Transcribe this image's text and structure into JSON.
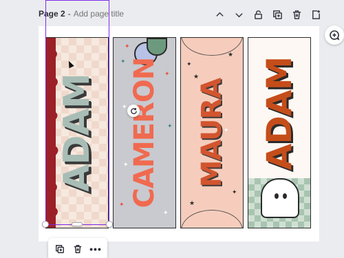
{
  "page": {
    "number_label": "Page 2",
    "separator": "-",
    "title_placeholder": "Add page title"
  },
  "toolbar": {
    "icons": [
      "chevron-up-icon",
      "chevron-down-icon",
      "lock-icon",
      "duplicate-page-icon",
      "delete-page-icon",
      "add-page-icon"
    ]
  },
  "side_action": {
    "icon": "comment-add-icon"
  },
  "bookmarks": [
    {
      "name": "ADAM",
      "colors": {
        "text": "#a8bdb6",
        "accent": "#9b2027",
        "background": "#f6e9df"
      }
    },
    {
      "name": "CAMERON",
      "colors": {
        "text": "#f06a4f",
        "background": "#c9c9d0"
      }
    },
    {
      "name": "MAURA",
      "colors": {
        "text": "#d2552f",
        "background": "#f6cdbd"
      }
    },
    {
      "name": "ADAM",
      "colors": {
        "text": "#c54d1a",
        "background": "#fdf8f3",
        "accent": "#cfe0d3"
      }
    }
  ],
  "selection": {
    "color": "#7d2ae8"
  },
  "float_toolbar": {
    "icons": [
      "duplicate-icon",
      "trash-icon"
    ],
    "more_label": "•••"
  }
}
